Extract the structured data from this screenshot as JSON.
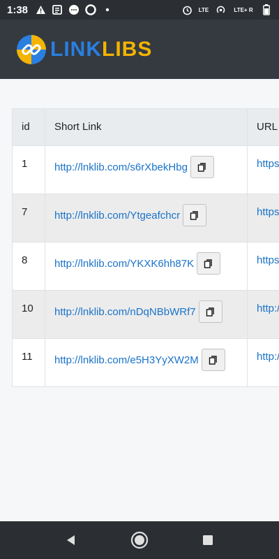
{
  "status": {
    "time": "1:38",
    "lte_label": "LTE",
    "lte_r_label": "LTE+ R",
    "left_icons": [
      "warning-icon",
      "news-icon",
      "message-icon",
      "circle-icon",
      "dot-icon"
    ],
    "right_icons": [
      "alarm-icon",
      "phone-lte-icon",
      "hotspot-icon",
      "signal-icon",
      "battery-icon"
    ]
  },
  "header": {
    "brand_part1": "LINK",
    "brand_part2": "LIBS",
    "colors": {
      "link": "#2a7fe0",
      "libs": "#f4b400",
      "bar": "#343a40"
    }
  },
  "table": {
    "headers": {
      "id": "id",
      "short_link": "Short Link",
      "url": "URL"
    },
    "rows": [
      {
        "id": "1",
        "short": "http://lnklib.com/s6rXbekHbg",
        "url": "https:"
      },
      {
        "id": "7",
        "short": "http://lnklib.com/Ytgeafchcr",
        "url": "https:"
      },
      {
        "id": "8",
        "short": "http://lnklib.com/YKXK6hh87K",
        "url": "https:"
      },
      {
        "id": "10",
        "short": "http://lnklib.com/nDqNBbWRf7",
        "url": "http:/"
      },
      {
        "id": "11",
        "short": "http://lnklib.com/e5H3YyXW2M",
        "url": "http:/"
      }
    ]
  },
  "nav": {
    "icons": [
      "back-icon",
      "home-icon",
      "recents-icon"
    ]
  }
}
